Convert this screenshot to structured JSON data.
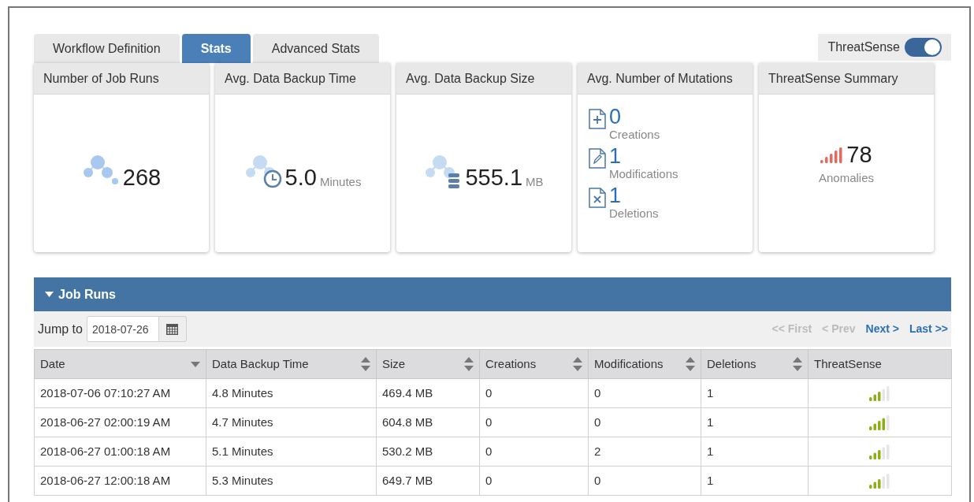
{
  "tabs": [
    {
      "label": "Workflow Definition",
      "selected": false
    },
    {
      "label": "Stats",
      "selected": true
    },
    {
      "label": "Advanced Stats",
      "selected": false
    }
  ],
  "threatsense_toggle": {
    "label": "ThreatSense",
    "on": true
  },
  "cards": [
    {
      "kind": "count",
      "title": "Number of Job Runs",
      "value": "268"
    },
    {
      "kind": "duration",
      "title": "Avg. Data Backup Time",
      "value": "5.0",
      "unit": "Minutes"
    },
    {
      "kind": "size",
      "title": "Avg. Data Backup Size",
      "value": "555.1",
      "unit": "MB"
    },
    {
      "kind": "mutations",
      "title": "Avg. Number of Mutations",
      "items": [
        {
          "value": "0",
          "label": "Creations"
        },
        {
          "value": "1",
          "label": "Modifications"
        },
        {
          "value": "1",
          "label": "Deletions"
        }
      ]
    },
    {
      "kind": "anomalies",
      "title": "ThreatSense Summary",
      "value": "78",
      "label": "Anomalies"
    }
  ],
  "job_runs": {
    "title": "Job Runs",
    "expanded": true,
    "jump_to": {
      "label": "Jump to",
      "value": "2018-07-26"
    },
    "pagination": [
      {
        "label": "<< First",
        "disabled": true
      },
      {
        "label": "< Prev",
        "disabled": true
      },
      {
        "label": "Next >",
        "disabled": false
      },
      {
        "label": "Last >>",
        "disabled": false
      }
    ],
    "columns": [
      {
        "label": "Date",
        "sorted": true
      },
      {
        "label": "Data Backup Time",
        "sortable": true,
        "sorted": false
      },
      {
        "label": "Size",
        "sortable": true,
        "sorted": false
      },
      {
        "label": "Creations",
        "sortable": true,
        "sorted": false
      },
      {
        "label": "Modifications",
        "sortable": true,
        "sorted": false
      },
      {
        "label": "Deletions",
        "sortable": true,
        "sorted": false
      },
      {
        "label": "ThreatSense",
        "sortable": false,
        "sorted": false
      }
    ],
    "rows": [
      {
        "date": "2018-07-06 07:10:27 AM",
        "time": "4.8 Minutes",
        "size": "469.4 MB",
        "creations": "0",
        "modifications": "0",
        "deletions": "1",
        "threatsense": {
          "level": 0.6
        }
      },
      {
        "date": "2018-06-27 02:00:19 AM",
        "time": "4.7 Minutes",
        "size": "604.8 MB",
        "creations": "0",
        "modifications": "0",
        "deletions": "1",
        "threatsense": {
          "level": 0.8
        }
      },
      {
        "date": "2018-06-27 01:00:18 AM",
        "time": "5.1 Minutes",
        "size": "530.2 MB",
        "creations": "0",
        "modifications": "2",
        "deletions": "1",
        "threatsense": {
          "level": 0.6
        }
      },
      {
        "date": "2018-06-27 12:00:18 AM",
        "time": "5.3 Minutes",
        "size": "649.7 MB",
        "creations": "0",
        "modifications": "0",
        "deletions": "1",
        "threatsense": {
          "level": 0.6
        }
      }
    ]
  }
}
